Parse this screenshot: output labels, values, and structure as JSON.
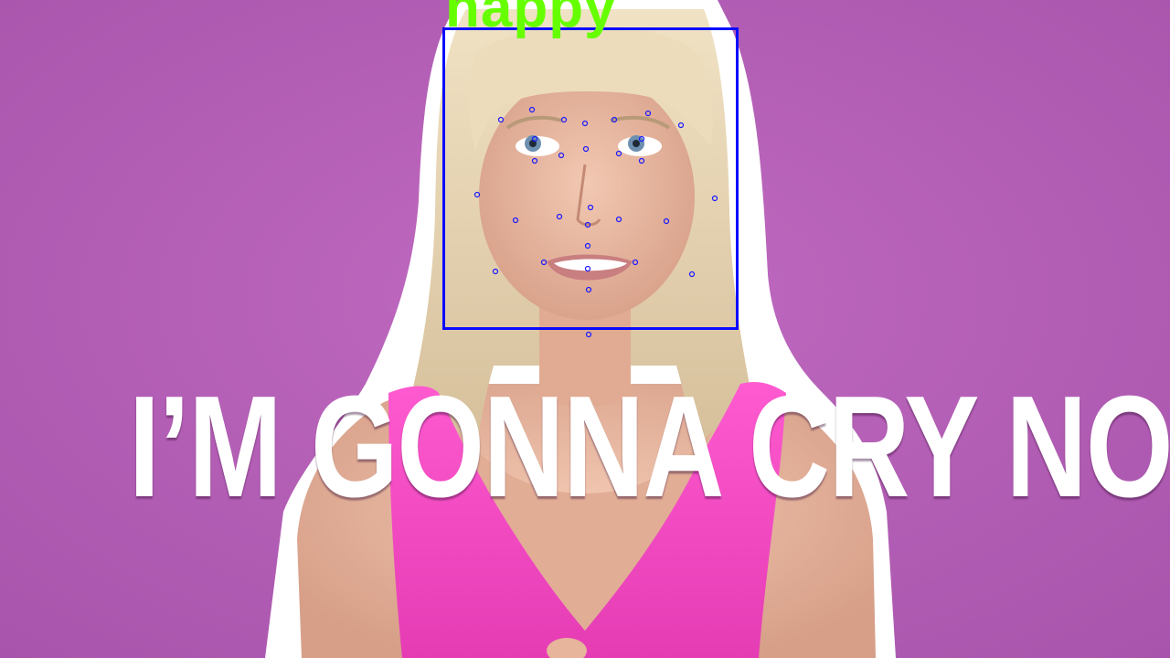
{
  "caption": "I’M GONNA CRY NOW",
  "detection": {
    "emotion_label": "happy",
    "label_color": "#66ff00",
    "box_color": "#0a0aff"
  },
  "colors": {
    "background": "#b864b8",
    "top": "#ffffff",
    "skin": "#e7b8a0",
    "hair": "#e8d7b4"
  }
}
